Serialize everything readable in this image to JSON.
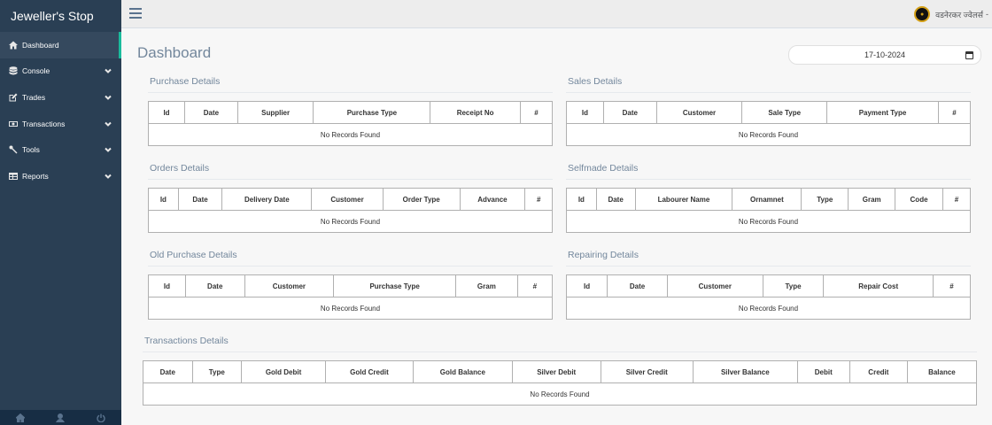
{
  "app": {
    "brand": "Jeweller's Stop"
  },
  "sidebar": {
    "items": [
      {
        "label": "Dashboard",
        "icon": "home-icon",
        "active": true
      },
      {
        "label": "Console",
        "icon": "database-icon"
      },
      {
        "label": "Trades",
        "icon": "edit-icon"
      },
      {
        "label": "Transactions",
        "icon": "money-icon"
      },
      {
        "label": "Tools",
        "icon": "wrench-icon"
      },
      {
        "label": "Reports",
        "icon": "table-icon"
      }
    ],
    "footer_icons": [
      "home-icon",
      "user-icon",
      "power-icon"
    ]
  },
  "topbar": {
    "user_name": "वडनेरकर ज्वेलर्स"
  },
  "page": {
    "title": "Dashboard",
    "date_value": "17-10-2024"
  },
  "empty_text": "No Records Found",
  "panels": {
    "purchase": {
      "title": "Purchase Details",
      "columns": [
        "Id",
        "Date",
        "Supplier",
        "Purchase Type",
        "Receipt No",
        "#"
      ]
    },
    "sales": {
      "title": "Sales Details",
      "columns": [
        "Id",
        "Date",
        "Customer",
        "Sale Type",
        "Payment Type",
        "#"
      ]
    },
    "orders": {
      "title": "Orders Details",
      "columns": [
        "Id",
        "Date",
        "Delivery Date",
        "Customer",
        "Order Type",
        "Advance",
        "#"
      ]
    },
    "selfmade": {
      "title": "Selfmade Details",
      "columns": [
        "Id",
        "Date",
        "Labourer Name",
        "Ornamnet",
        "Type",
        "Gram",
        "Code",
        "#"
      ]
    },
    "old_purchase": {
      "title": "Old Purchase Details",
      "columns": [
        "Id",
        "Date",
        "Customer",
        "Purchase Type",
        "Gram",
        "#"
      ]
    },
    "repairing": {
      "title": "Repairing Details",
      "columns": [
        "Id",
        "Date",
        "Customer",
        "Type",
        "Repair Cost",
        "#"
      ]
    },
    "transactions": {
      "title": "Transactions Details",
      "columns": [
        "Date",
        "Type",
        "Gold Debit",
        "Gold Credit",
        "Gold Balance",
        "Silver Debit",
        "Silver Credit",
        "Silver Balance",
        "Debit",
        "Credit",
        "Balance"
      ]
    }
  }
}
